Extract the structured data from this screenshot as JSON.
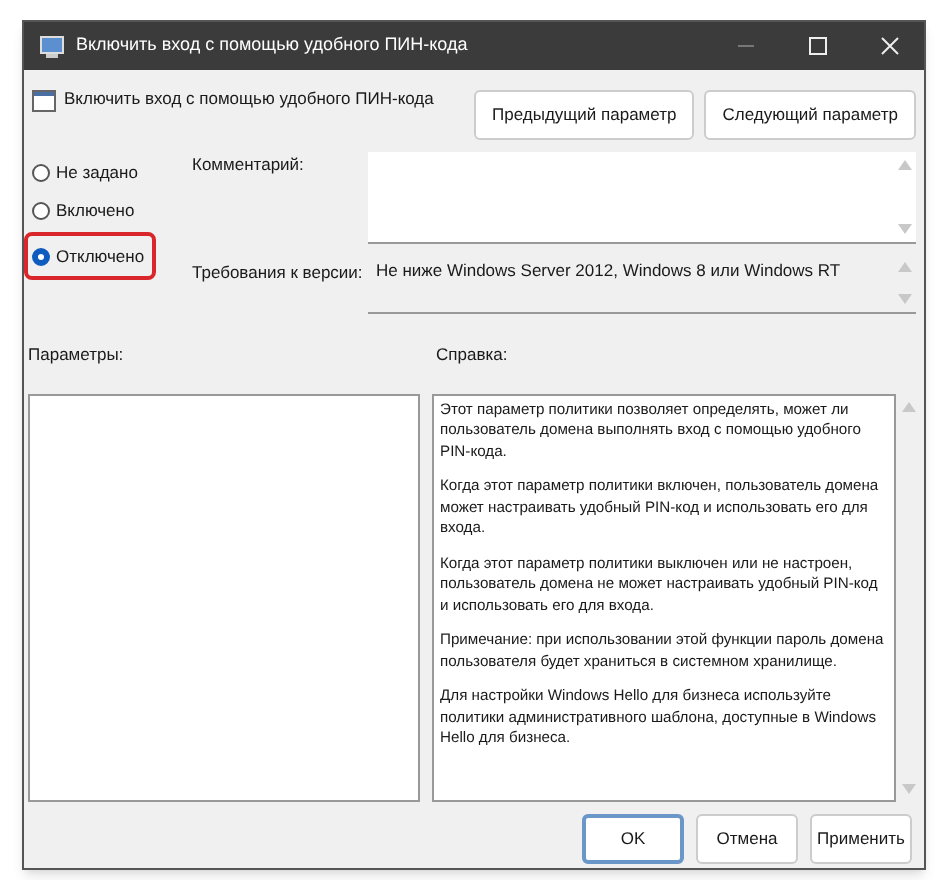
{
  "window": {
    "title": "Включить вход с помощью удобного ПИН-кода"
  },
  "header": {
    "title": "Включить вход с помощью удобного ПИН-кода",
    "buttons": [
      "Предыдущий параметр",
      "Следующий параметр"
    ]
  },
  "options": [
    {
      "label": "Не задано",
      "selected": false,
      "highlighted": false
    },
    {
      "label": "Включено",
      "selected": false,
      "highlighted": false
    },
    {
      "label": "Отключено",
      "selected": true,
      "highlighted": true
    }
  ],
  "comment": {
    "label": "Комментарий:"
  },
  "requirements": {
    "label": "Требования к версии:",
    "value": "Не ниже Windows Server 2012, Windows 8 или Windows RT"
  },
  "parameters": {
    "label": "Параметры:"
  },
  "help": {
    "label": "Справка:",
    "paragraphs": [
      "Этот параметр политики позволяет определять, может ли пользователь домена выполнять вход с помощью удобного PIN-кода.",
      "Когда этот параметр политики включен, пользователь домена может настраивать удобный PIN-код и использовать его для входа.",
      "Когда этот параметр политики выключен или не настроен, пользователь домена не может настраивать удобный PIN-код и использовать его для входа.",
      "Примечание: при использовании этой функции пароль домена пользователя будет храниться в системном хранилище.",
      "Для настройки Windows Hello для бизнеса используйте политики административного шаблона, доступные в Windows Hello для бизнеса."
    ]
  },
  "buttons": [
    {
      "label": "OK",
      "default": true
    },
    {
      "label": "Отмена",
      "default": false
    },
    {
      "label": "Применить",
      "default": false
    }
  ]
}
